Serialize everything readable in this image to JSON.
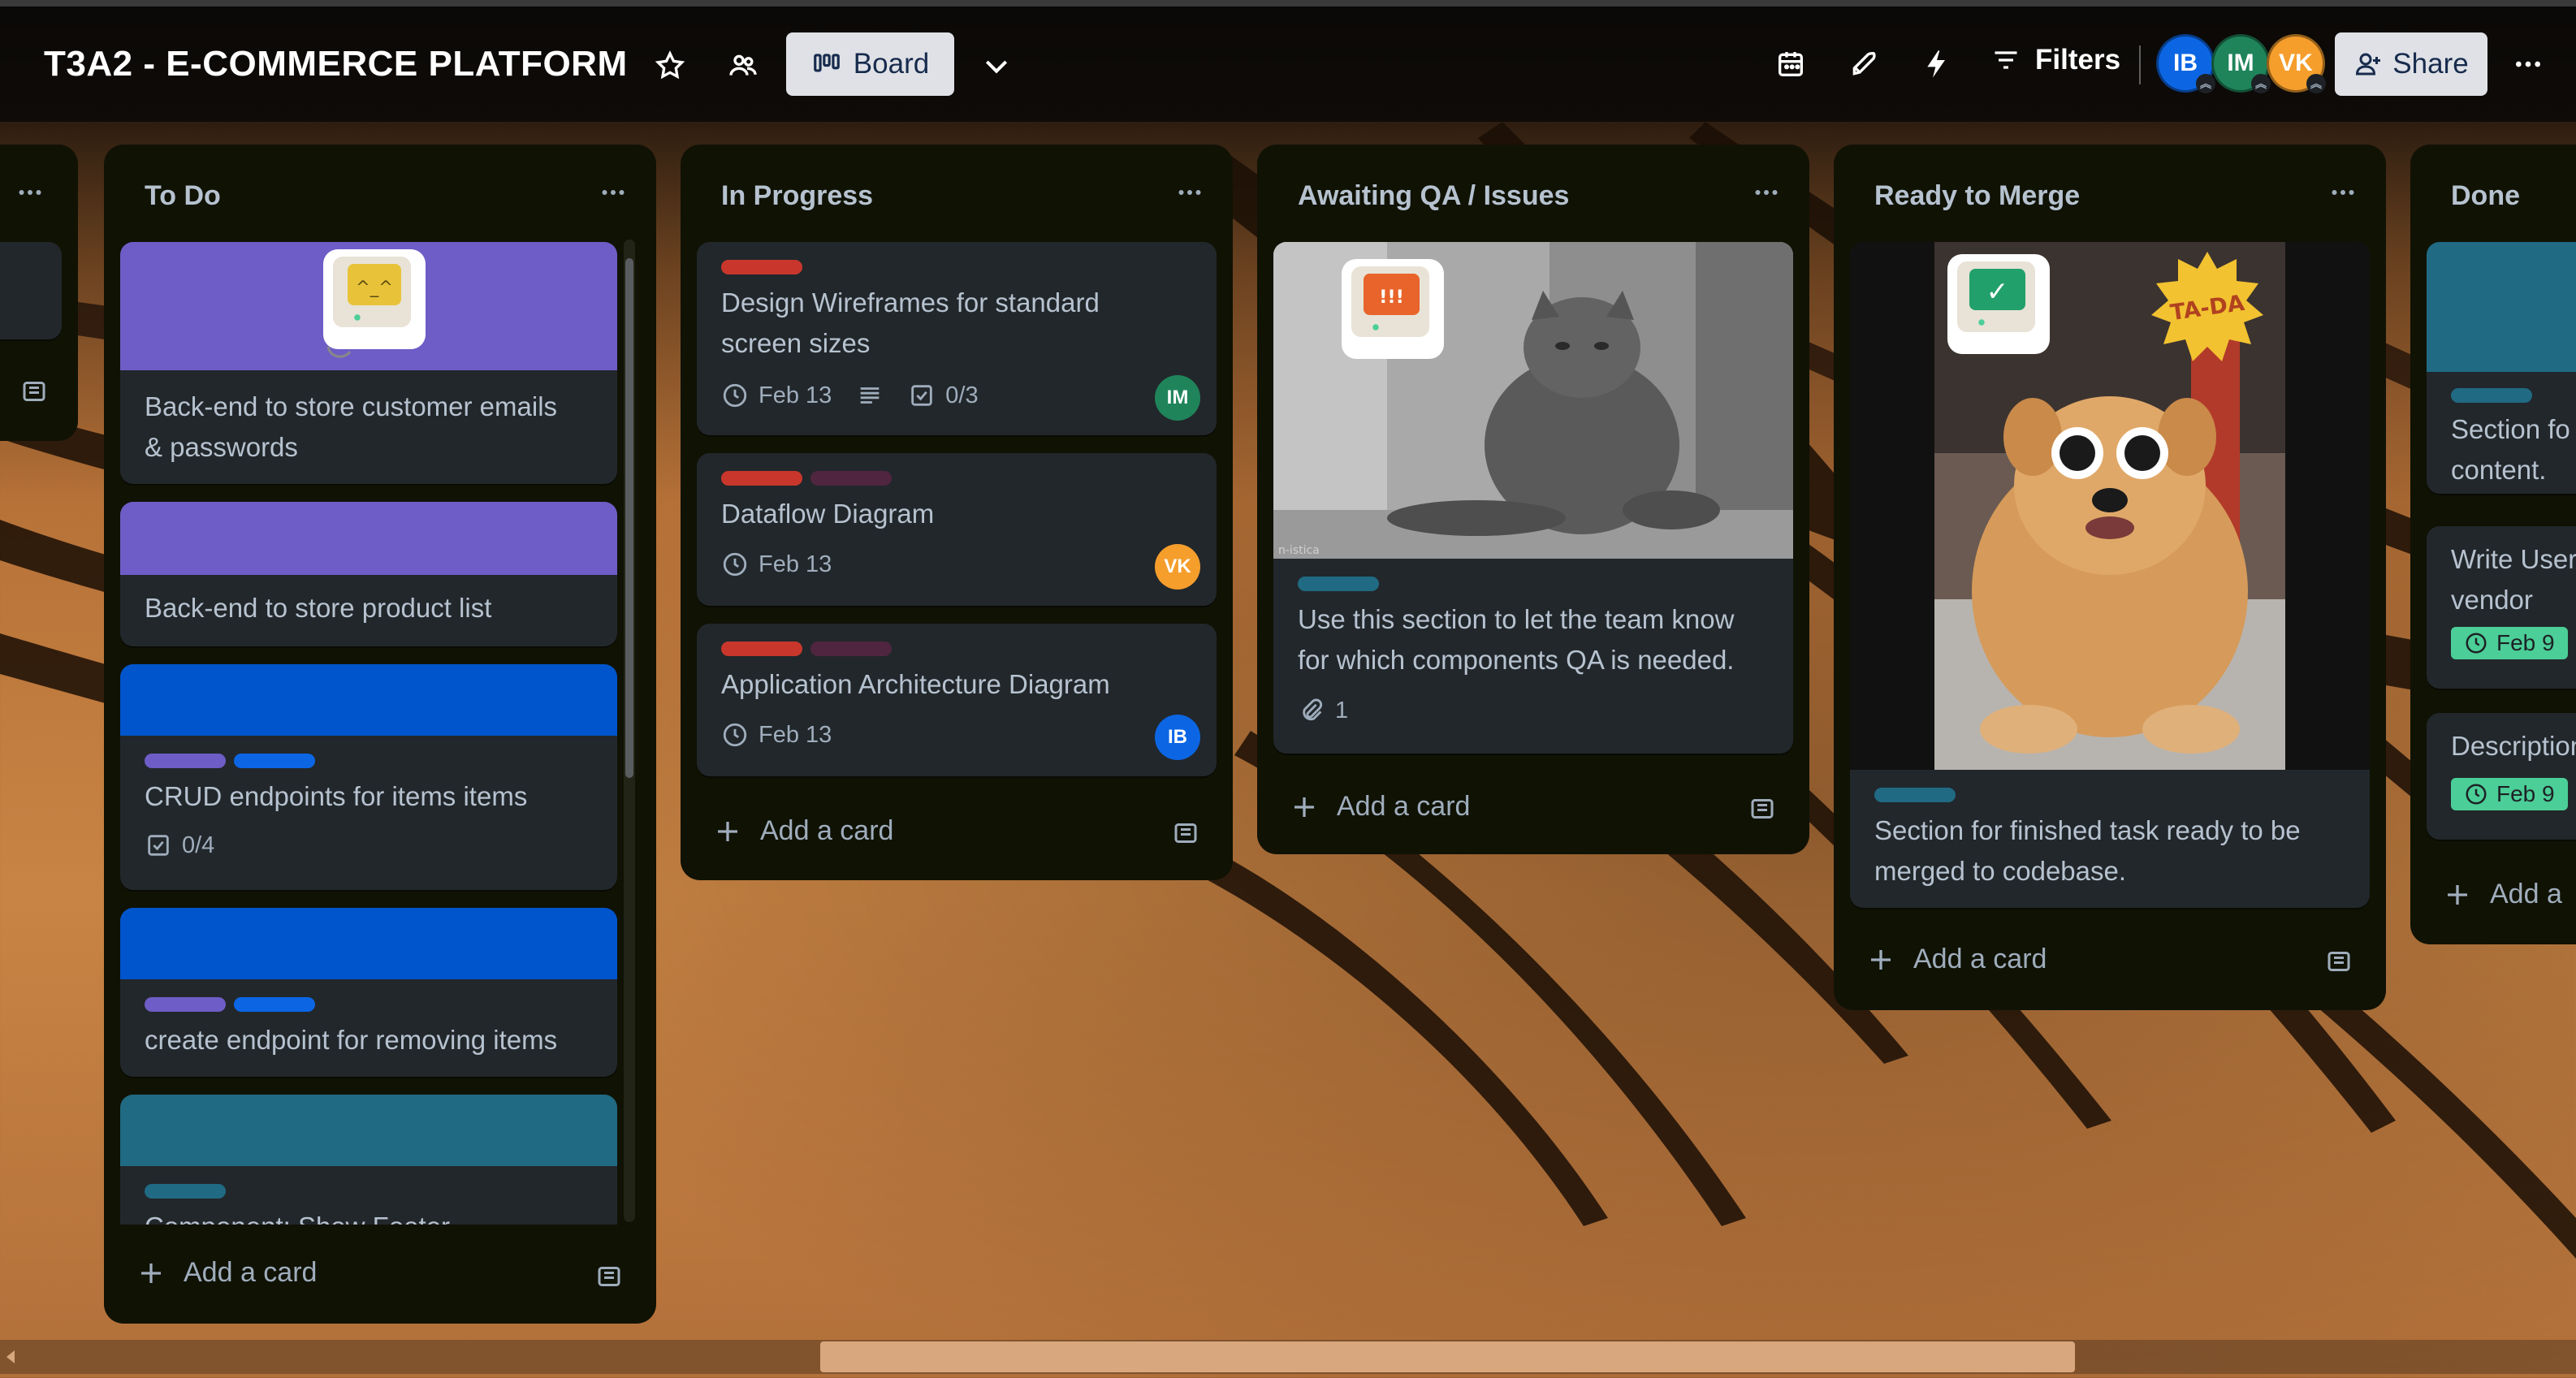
{
  "header": {
    "board_title": "T3A2 - E-COMMERCE PLATFORM",
    "view_label": "Board",
    "filters_label": "Filters",
    "share_label": "Share",
    "members": [
      {
        "initials": "IB",
        "color": "#0c66e4"
      },
      {
        "initials": "IM",
        "color": "#1f845a"
      },
      {
        "initials": "VK",
        "color": "#f59e2c"
      }
    ]
  },
  "lists": {
    "todo": {
      "title": "To Do",
      "cards": [
        {
          "title_line1": "Back-end to store customer emails",
          "title_line2": "& passwords",
          "cover_color": "#6e5dc6"
        },
        {
          "title": "Back-end to store product list",
          "cover_color": "#6e5dc6"
        },
        {
          "title": "CRUD endpoints for items items",
          "checklist": "0/4",
          "cover_color": "#0055cc"
        },
        {
          "title": "create endpoint for removing items",
          "cover_color": "#0055cc"
        },
        {
          "title": "Component: Show Footer",
          "cover_color": "#206a83"
        }
      ],
      "add_card": "Add a card"
    },
    "in_progress": {
      "title": "In Progress",
      "cards": [
        {
          "title_line1": "Design Wireframes for standard",
          "title_line2": "screen sizes",
          "date": "Feb 13",
          "checklist": "0/3",
          "member": "IM"
        },
        {
          "title": "Dataflow Diagram",
          "date": "Feb 13",
          "member": "VK"
        },
        {
          "title": "Application Architecture Diagram",
          "date": "Feb 13",
          "member": "IB"
        }
      ],
      "add_card": "Add a card"
    },
    "awaiting_qa": {
      "title": "Awaiting QA / Issues",
      "cards": [
        {
          "title_line1": "Use this section to let the team know",
          "title_line2": "for which components QA is needed.",
          "attachments": "1",
          "image_caption": "n-istica",
          "sticker_text": "!!!"
        }
      ],
      "add_card": "Add a card"
    },
    "ready_merge": {
      "title": "Ready to Merge",
      "cards": [
        {
          "title_line1": "Section for finished task ready to be",
          "title_line2": "merged to codebase.",
          "sticker_text": "TA-DA",
          "check_mark": "✓"
        }
      ],
      "add_card": "Add a card"
    },
    "done": {
      "title": "Done",
      "cards": [
        {
          "title_line1": "Section fo",
          "title_line2": "content."
        },
        {
          "title_line1": "Write User",
          "title_line2": "vendor",
          "date": "Feb 9"
        },
        {
          "title": "Description",
          "date": "Feb 9"
        }
      ],
      "add_card": "Add a"
    }
  },
  "colors": {
    "label_red": "#c9372c",
    "label_maroon": "#50253f",
    "label_purple": "#6e5dc6",
    "label_blue": "#0c66e4",
    "label_teal": "#206a83",
    "date_green": "#4bce97"
  }
}
